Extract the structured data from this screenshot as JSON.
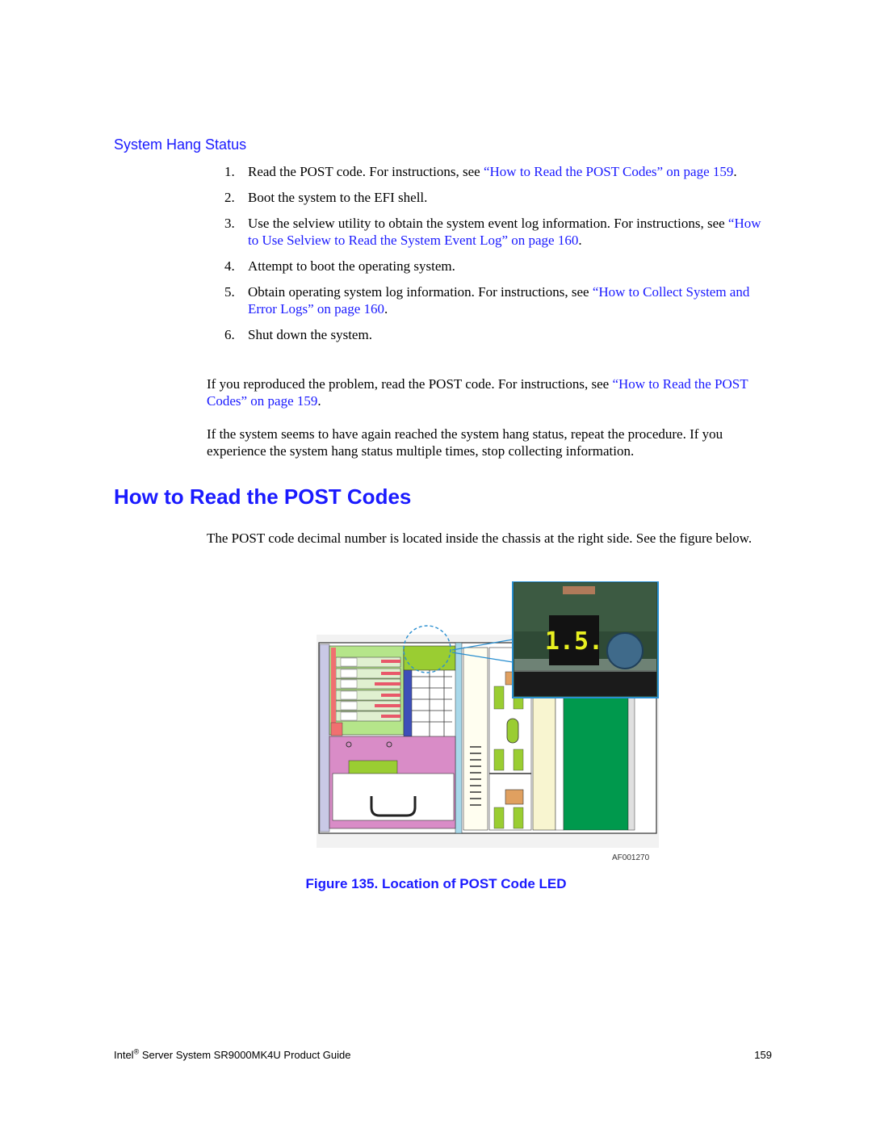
{
  "section": {
    "subheading": "System Hang Status",
    "steps": [
      {
        "num": "1.",
        "text": "Read the POST code. For instructions, see ",
        "link": "“How to Read the POST Codes” on page 159",
        "after": "."
      },
      {
        "num": "2.",
        "text": "Boot the system to the EFI shell.",
        "link": "",
        "after": ""
      },
      {
        "num": "3.",
        "text": "Use the selview utility to obtain the system event log information. For instructions, see ",
        "link": "“How to Use Selview to Read the System Event Log” on page 160",
        "after": "."
      },
      {
        "num": "4.",
        "text": "Attempt to boot the operating system.",
        "link": "",
        "after": ""
      },
      {
        "num": "5.",
        "text": "Obtain operating system log information. For instructions, see ",
        "link": "“How to Collect System and Error Logs” on page 160",
        "after": "."
      },
      {
        "num": "6.",
        "text": "Shut down the system.",
        "link": "",
        "after": ""
      }
    ],
    "para1": {
      "text": "If you reproduced the problem, read the POST code. For instructions, see ",
      "link": "“How to Read the POST Codes” on page 159",
      "after": "."
    },
    "para2": "If the system seems to have again reached the system hang status, repeat the procedure. If you experience the system hang status multiple times, stop collecting information."
  },
  "post_section": {
    "heading": "How to Read the POST Codes",
    "intro": "The POST code decimal number is located inside the chassis at the right side. See the figure below.",
    "figure": {
      "led_display": "1.5.",
      "figure_id": "AF001270",
      "caption": "Figure 135. Location of POST Code LED"
    }
  },
  "footer": {
    "brand": "Intel",
    "reg": "®",
    "title": " Server System SR9000MK4U Product Guide",
    "page": "159"
  },
  "colors": {
    "link": "#1a1aff",
    "board_green": "#00994d",
    "lime": "#9acd32",
    "pink": "#d98cc7",
    "light_blue": "#a8d8ea"
  }
}
